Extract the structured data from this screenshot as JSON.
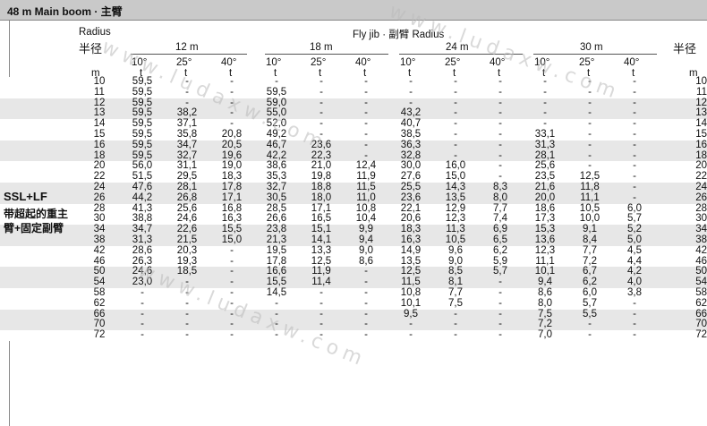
{
  "title": "48 m   Main boom · 主臂",
  "headers": {
    "radius_en": "Radius",
    "radius_cn": "半径",
    "radius_cn_right": "半径",
    "fly_jib": "Fly jib · 副臂 Radius",
    "jib_lengths": [
      "12 m",
      "18 m",
      "24 m",
      "30 m"
    ],
    "angles": [
      "10°",
      "25°",
      "40°"
    ],
    "unit_m": "m",
    "unit_t": "t"
  },
  "side_label": {
    "line1": "SSL+LF",
    "line2": "带超起的重主",
    "line3": "臂+固定副臂"
  },
  "watermark": "www.ludaxw.com",
  "rows": [
    {
      "r": "10",
      "v": [
        "59,5",
        "-",
        "-",
        "-",
        "-",
        "-",
        "-",
        "-",
        "-",
        "-",
        "-",
        "-"
      ]
    },
    {
      "r": "11",
      "v": [
        "59,5",
        "-",
        "-",
        "59,5",
        "-",
        "-",
        "-",
        "-",
        "-",
        "-",
        "-",
        "-"
      ]
    },
    {
      "r": "12",
      "v": [
        "59,5",
        "-",
        "-",
        "59,0",
        "-",
        "-",
        "-",
        "-",
        "-",
        "-",
        "-",
        "-"
      ]
    },
    {
      "r": "13",
      "v": [
        "59,5",
        "38,2",
        "-",
        "55,0",
        "-",
        "-",
        "43,2",
        "-",
        "-",
        "-",
        "-",
        "-"
      ]
    },
    {
      "r": "14",
      "v": [
        "59,5",
        "37,1",
        "-",
        "52,0",
        "-",
        "-",
        "40,7",
        "-",
        "-",
        "-",
        "-",
        "-"
      ]
    },
    {
      "r": "15",
      "v": [
        "59,5",
        "35,8",
        "20,8",
        "49,2",
        "-",
        "-",
        "38,5",
        "-",
        "-",
        "33,1",
        "-",
        "-"
      ]
    },
    {
      "r": "16",
      "v": [
        "59,5",
        "34,7",
        "20,5",
        "46,7",
        "23,6",
        "-",
        "36,3",
        "-",
        "-",
        "31,3",
        "-",
        "-"
      ]
    },
    {
      "r": "18",
      "v": [
        "59,5",
        "32,7",
        "19,6",
        "42,2",
        "22,3",
        "-",
        "32,8",
        "-",
        "-",
        "28,1",
        "-",
        "-"
      ]
    },
    {
      "r": "20",
      "v": [
        "56,0",
        "31,1",
        "19,0",
        "38,6",
        "21,0",
        "12,4",
        "30,0",
        "16,0",
        "-",
        "25,6",
        "-",
        "-"
      ]
    },
    {
      "r": "22",
      "v": [
        "51,5",
        "29,5",
        "18,3",
        "35,3",
        "19,8",
        "11,9",
        "27,6",
        "15,0",
        "-",
        "23,5",
        "12,5",
        "-"
      ]
    },
    {
      "r": "24",
      "v": [
        "47,6",
        "28,1",
        "17,8",
        "32,7",
        "18,8",
        "11,5",
        "25,5",
        "14,3",
        "8,3",
        "21,6",
        "11,8",
        "-"
      ]
    },
    {
      "r": "26",
      "v": [
        "44,2",
        "26,8",
        "17,1",
        "30,5",
        "18,0",
        "11,0",
        "23,6",
        "13,5",
        "8,0",
        "20,0",
        "11,1",
        "-"
      ]
    },
    {
      "r": "28",
      "v": [
        "41,3",
        "25,6",
        "16,8",
        "28,5",
        "17,1",
        "10,8",
        "22,1",
        "12,9",
        "7,7",
        "18,6",
        "10,5",
        "6,0"
      ]
    },
    {
      "r": "30",
      "v": [
        "38,8",
        "24,6",
        "16,3",
        "26,6",
        "16,5",
        "10,4",
        "20,6",
        "12,3",
        "7,4",
        "17,3",
        "10,0",
        "5,7"
      ]
    },
    {
      "r": "34",
      "v": [
        "34,7",
        "22,6",
        "15,5",
        "23,8",
        "15,1",
        "9,9",
        "18,3",
        "11,3",
        "6,9",
        "15,3",
        "9,1",
        "5,2"
      ]
    },
    {
      "r": "38",
      "v": [
        "31,3",
        "21,5",
        "15,0",
        "21,3",
        "14,1",
        "9,4",
        "16,3",
        "10,5",
        "6,5",
        "13,6",
        "8,4",
        "5,0"
      ]
    },
    {
      "r": "42",
      "v": [
        "28,6",
        "20,3",
        "-",
        "19,5",
        "13,3",
        "9,0",
        "14,9",
        "9,6",
        "6,2",
        "12,3",
        "7,7",
        "4,5"
      ]
    },
    {
      "r": "46",
      "v": [
        "26,3",
        "19,3",
        "-",
        "17,8",
        "12,5",
        "8,6",
        "13,5",
        "9,0",
        "5,9",
        "11,1",
        "7,2",
        "4,4"
      ]
    },
    {
      "r": "50",
      "v": [
        "24,6",
        "18,5",
        "-",
        "16,6",
        "11,9",
        "-",
        "12,5",
        "8,5",
        "5,7",
        "10,1",
        "6,7",
        "4,2"
      ]
    },
    {
      "r": "54",
      "v": [
        "23,0",
        "-",
        "-",
        "15,5",
        "11,4",
        "-",
        "11,5",
        "8,1",
        "-",
        "9,4",
        "6,2",
        "4,0"
      ]
    },
    {
      "r": "58",
      "v": [
        "-",
        "-",
        "-",
        "14,5",
        "-",
        "-",
        "10,8",
        "7,7",
        "-",
        "8,6",
        "6,0",
        "3,8"
      ]
    },
    {
      "r": "62",
      "v": [
        "-",
        "-",
        "-",
        "-",
        "-",
        "-",
        "10,1",
        "7,5",
        "-",
        "8,0",
        "5,7",
        "-"
      ]
    },
    {
      "r": "66",
      "v": [
        "-",
        "-",
        "-",
        "-",
        "-",
        "-",
        "9,5",
        "-",
        "-",
        "7,5",
        "5,5",
        "-"
      ]
    },
    {
      "r": "70",
      "v": [
        "-",
        "-",
        "-",
        "-",
        "-",
        "-",
        "-",
        "-",
        "-",
        "7,2",
        "-",
        "-"
      ]
    },
    {
      "r": "72",
      "v": [
        "-",
        "-",
        "-",
        "-",
        "-",
        "-",
        "-",
        "-",
        "-",
        "7,0",
        "-",
        "-"
      ]
    }
  ]
}
